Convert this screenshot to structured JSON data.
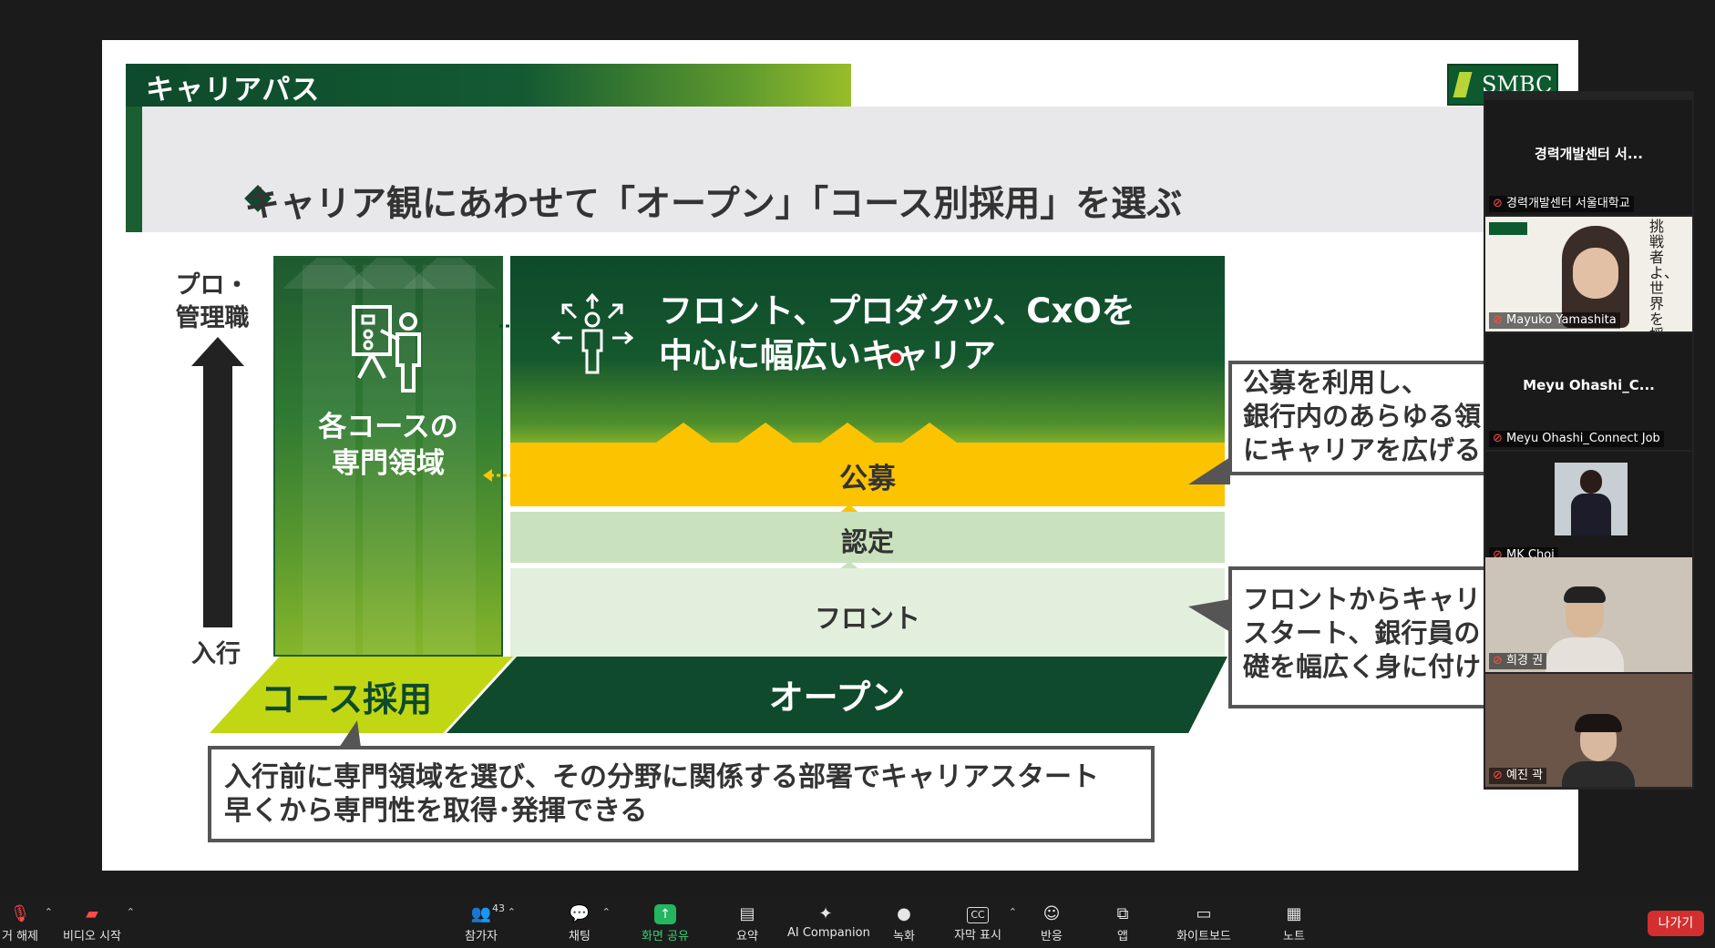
{
  "slide": {
    "title": "キャリアパス",
    "logo_text": "SMBC",
    "subtitle": "キャリア観にあわせて「オープン」「コース別採用」を選ぶ",
    "axis_top_line1": "プロ・",
    "axis_top_line2": "管理職",
    "axis_bottom": "入行",
    "course_label_line1": "各コースの",
    "course_label_line2": "専門領域",
    "career_line1": "フロント、プロダクツ、CxOを",
    "career_line2": "中心に幅広いキャリア",
    "koubo": "公募",
    "nintei": "認定",
    "front": "フロント",
    "course_hire": "コース採用",
    "open": "オープン",
    "callout_bottom_line1": "入行前に専門領域を選び、その分野に関係する部署でキャリアスタート",
    "callout_bottom_line2": "早くから専門性を取得･発揮できる",
    "callout_koubo_line1": "公募を利用し、",
    "callout_koubo_line2": "銀行内のあらゆる領",
    "callout_koubo_line3": "にキャリアを広げる",
    "callout_front_line1": "フロントからキャリ",
    "callout_front_line2": "スタート、銀行員の",
    "callout_front_line3": "礎を幅広く身に付け"
  },
  "participants": [
    {
      "tile_title": "경력개발센터 서...",
      "name": "경력개발센터 서울대학교"
    },
    {
      "name": "Mayuko Yamashita",
      "overlay_text": "挑戦者よ、世界を揺らせ"
    },
    {
      "tile_title": "Meyu  Ohashi_C...",
      "name": "Meyu Ohashi_Connect Job"
    },
    {
      "name": "MK Choi"
    },
    {
      "name": "희경 권"
    },
    {
      "name": "예진 곽"
    }
  ],
  "toolbar": {
    "mute": "거 해제",
    "video": "비디오 시작",
    "participants": "참가자",
    "participants_count": "43",
    "chat": "채팅",
    "share": "화면 공유",
    "summary": "요약",
    "ai": "AI Companion",
    "record": "녹화",
    "captions": "자막 표시",
    "reactions": "반응",
    "apps": "앱",
    "whiteboard": "화이트보드",
    "notes": "노트",
    "leave": "나가기"
  }
}
